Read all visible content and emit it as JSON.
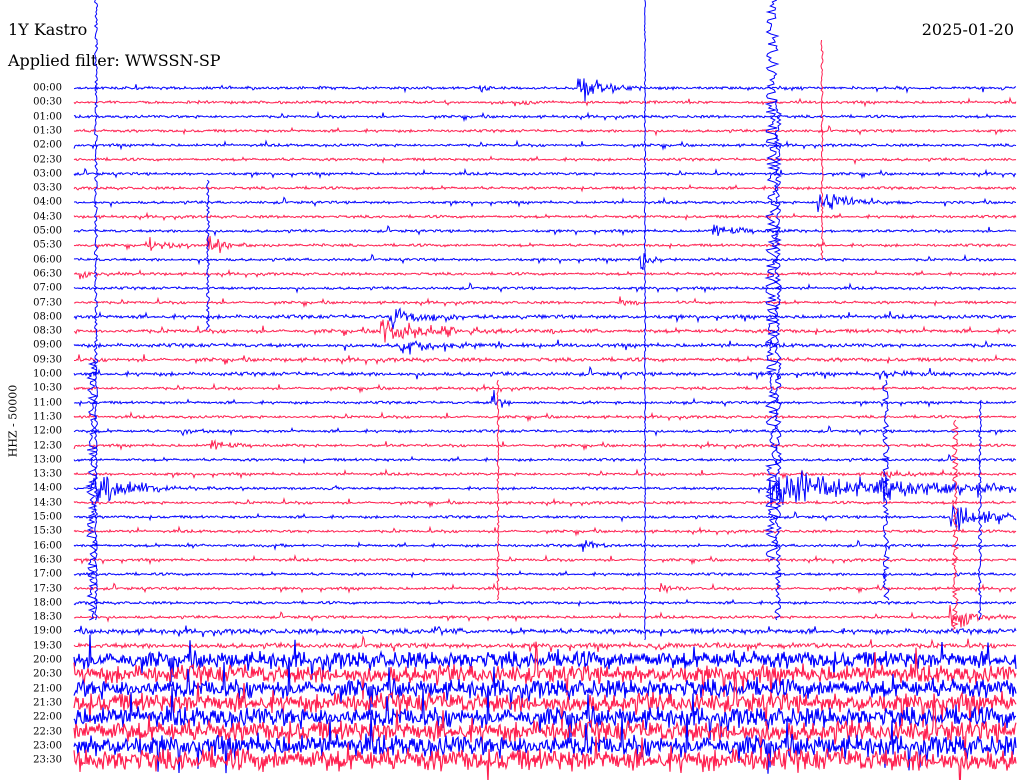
{
  "header": {
    "station": "1Y Kastro",
    "date": "2025-01-20",
    "filter": "Applied filter: WWSSN-SP",
    "channel": "HHZ - 50000"
  },
  "colors": {
    "trace_a": "#0000ff",
    "trace_b": "#ff2050",
    "background": "#ffffff"
  },
  "chart_data": {
    "type": "line",
    "title": "1Y Kastro",
    "ylabel": "HHZ - 50000",
    "rows": [
      "00:00",
      "00:30",
      "01:00",
      "01:30",
      "02:00",
      "02:30",
      "03:00",
      "03:30",
      "04:00",
      "04:30",
      "05:00",
      "05:30",
      "06:00",
      "06:30",
      "07:00",
      "07:30",
      "08:00",
      "08:30",
      "09:00",
      "09:30",
      "10:00",
      "10:30",
      "11:00",
      "11:30",
      "12:00",
      "12:30",
      "13:00",
      "13:30",
      "14:00",
      "14:30",
      "15:00",
      "15:30",
      "16:00",
      "16:30",
      "17:00",
      "17:30",
      "18:00",
      "18:30",
      "19:00",
      "19:30",
      "20:00",
      "20:30",
      "21:00",
      "21:30",
      "22:00",
      "22:30",
      "23:00",
      "23:30"
    ],
    "row_minutes": 30,
    "alternating_colors": [
      "blue",
      "red"
    ],
    "grid": false
  }
}
